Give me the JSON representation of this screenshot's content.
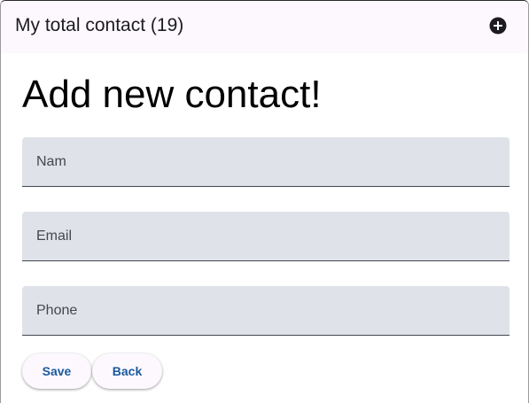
{
  "header": {
    "title": "My total contact (19)",
    "add_icon": "add-circle-icon"
  },
  "main": {
    "heading": "Add new contact!",
    "fields": {
      "name": {
        "value": "",
        "placeholder": "Nam"
      },
      "email": {
        "value": "",
        "placeholder": "Email"
      },
      "phone": {
        "value": "",
        "placeholder": "Phone"
      }
    },
    "buttons": {
      "save_label": "Save",
      "back_label": "Back"
    }
  },
  "colors": {
    "header_bg": "#fcf8fe",
    "field_bg": "#e0e2ea",
    "button_text": "#1a5a9c",
    "icon": "#1d1b20"
  }
}
